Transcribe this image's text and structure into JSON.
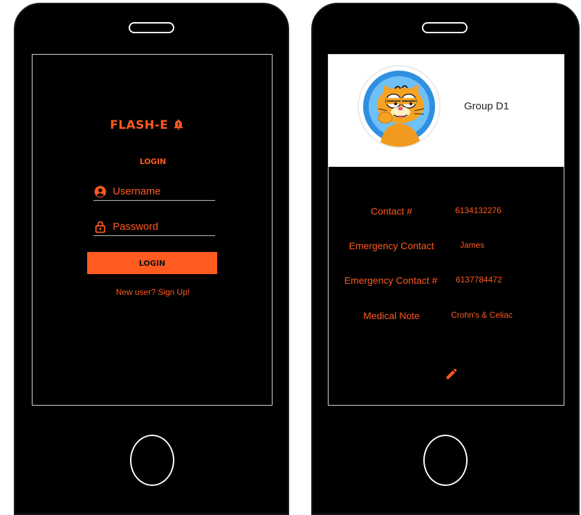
{
  "colors": {
    "accent": "#ff5a1f",
    "phone": "#000000",
    "header_bg": "#ffffff"
  },
  "login_screen": {
    "app_name": "FLASH-E",
    "logo_icon": "bell-icon",
    "heading": "LOGIN",
    "username": {
      "placeholder": "Username",
      "value": "",
      "icon": "user-icon"
    },
    "password": {
      "placeholder": "Password",
      "value": "",
      "icon": "lock-icon"
    },
    "login_button": "LOGIN",
    "signup_link": "New user? Sign Up!"
  },
  "profile_screen": {
    "avatar_icon": "garfield-avatar",
    "group_name": "Group D1",
    "fields": [
      {
        "label": "Contact #",
        "value": "6134132276"
      },
      {
        "label": "Emergency Contact",
        "value": "James"
      },
      {
        "label": "Emergency Contact #",
        "value": "6137784472"
      },
      {
        "label": "Medical Note",
        "value": "Crohn's & Celiac"
      }
    ],
    "edit_icon": "pencil-icon"
  }
}
